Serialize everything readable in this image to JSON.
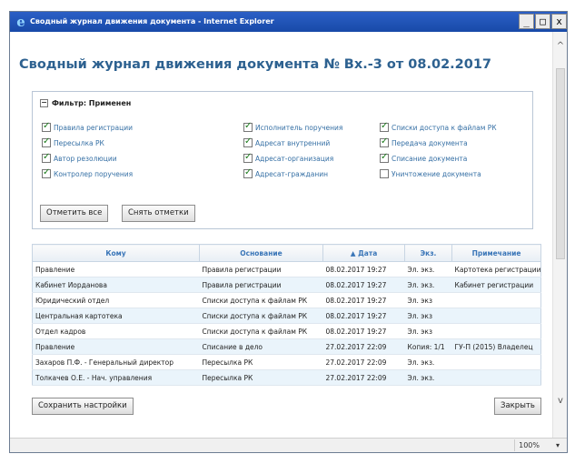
{
  "window": {
    "title": "Сводный журнал движения документа - Internet Explorer",
    "min_label": "_",
    "max_label": "□",
    "close_label": "x"
  },
  "page": {
    "title": "Сводный журнал движения документа № Вх.-3 от 08.02.2017"
  },
  "filter": {
    "header": "Фильтр: Применен",
    "collapse_symbol": "−",
    "columns": [
      [
        {
          "label": "Правила регистрации",
          "checked": true
        },
        {
          "label": "Пересылка РК",
          "checked": true
        },
        {
          "label": "Автор резолюции",
          "checked": true
        },
        {
          "label": "Контролер поручения",
          "checked": true
        }
      ],
      [
        {
          "label": "Исполнитель поручения",
          "checked": true
        },
        {
          "label": "Адресат внутренний",
          "checked": true
        },
        {
          "label": "Адресат-организация",
          "checked": true
        },
        {
          "label": "Адресат-гражданин",
          "checked": true
        }
      ],
      [
        {
          "label": "Списки доступа к файлам РК",
          "checked": true
        },
        {
          "label": "Передача документа",
          "checked": true
        },
        {
          "label": "Списание документа",
          "checked": true
        },
        {
          "label": "Уничтожение документа",
          "checked": false
        }
      ]
    ],
    "check_all_label": "Отметить все",
    "uncheck_label": "Снять отметки"
  },
  "table": {
    "headers": [
      "Кому",
      "Основание",
      "▲ Дата",
      "Экз.",
      "Примечание"
    ],
    "rows": [
      [
        "Правление",
        "Правила регистрации",
        "08.02.2017 19:27",
        "Эл. экз.",
        "Картотека регистрации"
      ],
      [
        "Кабинет Иорданова",
        "Правила регистрации",
        "08.02.2017 19:27",
        "Эл. экз.",
        "Кабинет регистрации"
      ],
      [
        "Юридический отдел",
        "Списки доступа к файлам РК",
        "08.02.2017 19:27",
        "Эл. экз",
        ""
      ],
      [
        "Центральная картотека",
        "Списки доступа к файлам РК",
        "08.02.2017 19:27",
        "Эл. экз",
        ""
      ],
      [
        "Отдел кадров",
        "Списки доступа к файлам РК",
        "08.02.2017 19:27",
        "Эл. экз",
        ""
      ],
      [
        "Правление",
        "Списание в дело",
        "27.02.2017 22:09",
        "Копия: 1/1",
        "ГУ-П (2015) Владелец"
      ],
      [
        "Захаров П.Ф. - Генеральный директор",
        "Пересылка РК",
        "27.02.2017 22:09",
        "Эл. экз.",
        ""
      ],
      [
        "Толкачев О.Е. - Нач. управления",
        "Пересылка РК",
        "27.02.2017 22:09",
        "Эл. экз.",
        ""
      ]
    ]
  },
  "buttons": {
    "save_settings": "Сохранить настройки",
    "close": "Закрыть"
  },
  "status": {
    "zoom": "100%",
    "zoom_arrow": "▾",
    "scroll_up": "^",
    "scroll_down": "v"
  }
}
